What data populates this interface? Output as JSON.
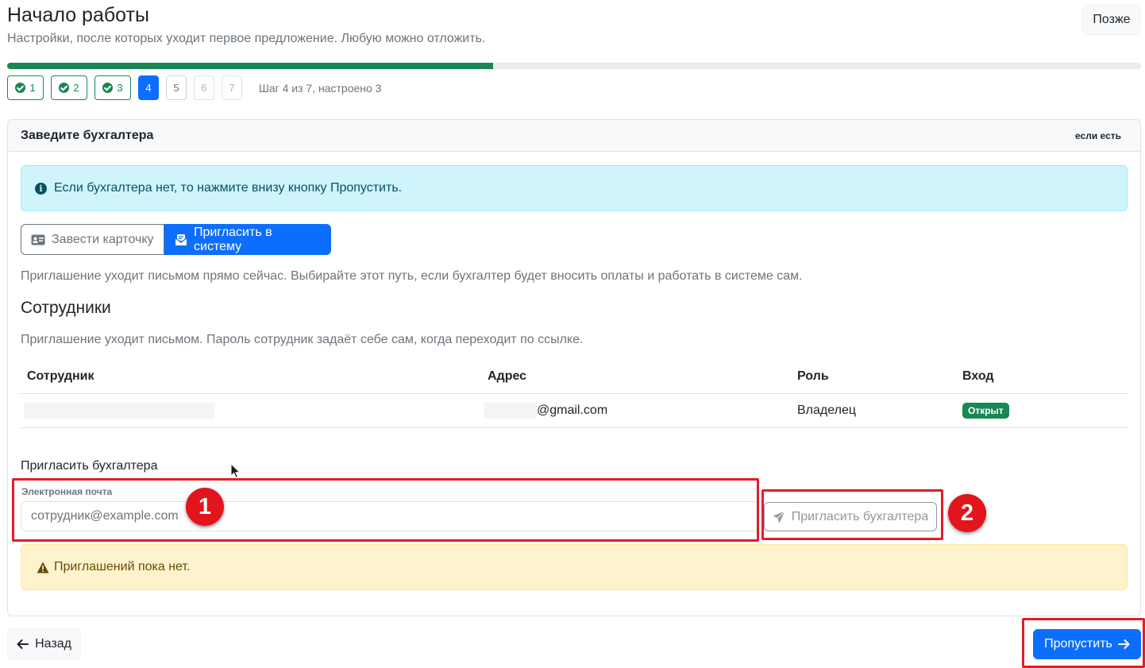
{
  "header": {
    "title": "Начало работы",
    "subtitle": "Настройки, после которых уходит первое предложение. Любую можно отложить.",
    "later_label": "Позже"
  },
  "progress": {
    "fraction": 0.4286,
    "steps": [
      {
        "label": "1",
        "state": "done"
      },
      {
        "label": "2",
        "state": "done"
      },
      {
        "label": "3",
        "state": "done"
      },
      {
        "label": "4",
        "state": "active"
      },
      {
        "label": "5",
        "state": "todo"
      },
      {
        "label": "6",
        "state": "todo"
      },
      {
        "label": "7",
        "state": "todo"
      }
    ],
    "status_text": "Шаг 4 из 7, настроено 3"
  },
  "card": {
    "title": "Заведите бухгалтера",
    "hint": "если есть",
    "info_alert": "Если бухгалтера нет, то нажмите внизу кнопку Пропустить.",
    "mode_options": {
      "card": "Завести карточку",
      "invite": "Пригласить в систему"
    },
    "invite_description": "Приглашение уходит письмом прямо сейчас. Выбирайте этот путь, если бухгалтер будет вносить оплаты и работать в системе сам.",
    "employees": {
      "title": "Сотрудники",
      "description": "Приглашение уходит письмом. Пароль сотрудник задаёт себе сам, когда переходит по ссылке.",
      "columns": [
        "Сотрудник",
        "Адрес",
        "Роль",
        "Вход"
      ],
      "rows": [
        {
          "name": "",
          "address": "@gmail.com",
          "role": "Владелец",
          "access": "Открыт"
        }
      ]
    },
    "invite_form": {
      "title": "Пригласить бухгалтера",
      "email_label": "Электронная почта",
      "email_placeholder": "сотрудник@example.com",
      "email_value": "",
      "submit_label": "Пригласить бухгалтера"
    },
    "warning_alert": "Приглашений пока нет."
  },
  "footer": {
    "back_label": "Назад",
    "skip_label": "Пропустить"
  },
  "annotations": {
    "marker_1": "1",
    "marker_2": "2"
  },
  "colors": {
    "primary": "#0d6efd",
    "success": "#198754",
    "info_bg": "#cff4fc",
    "warning_bg": "#fff3cd",
    "annotation_red": "#e3141b"
  }
}
